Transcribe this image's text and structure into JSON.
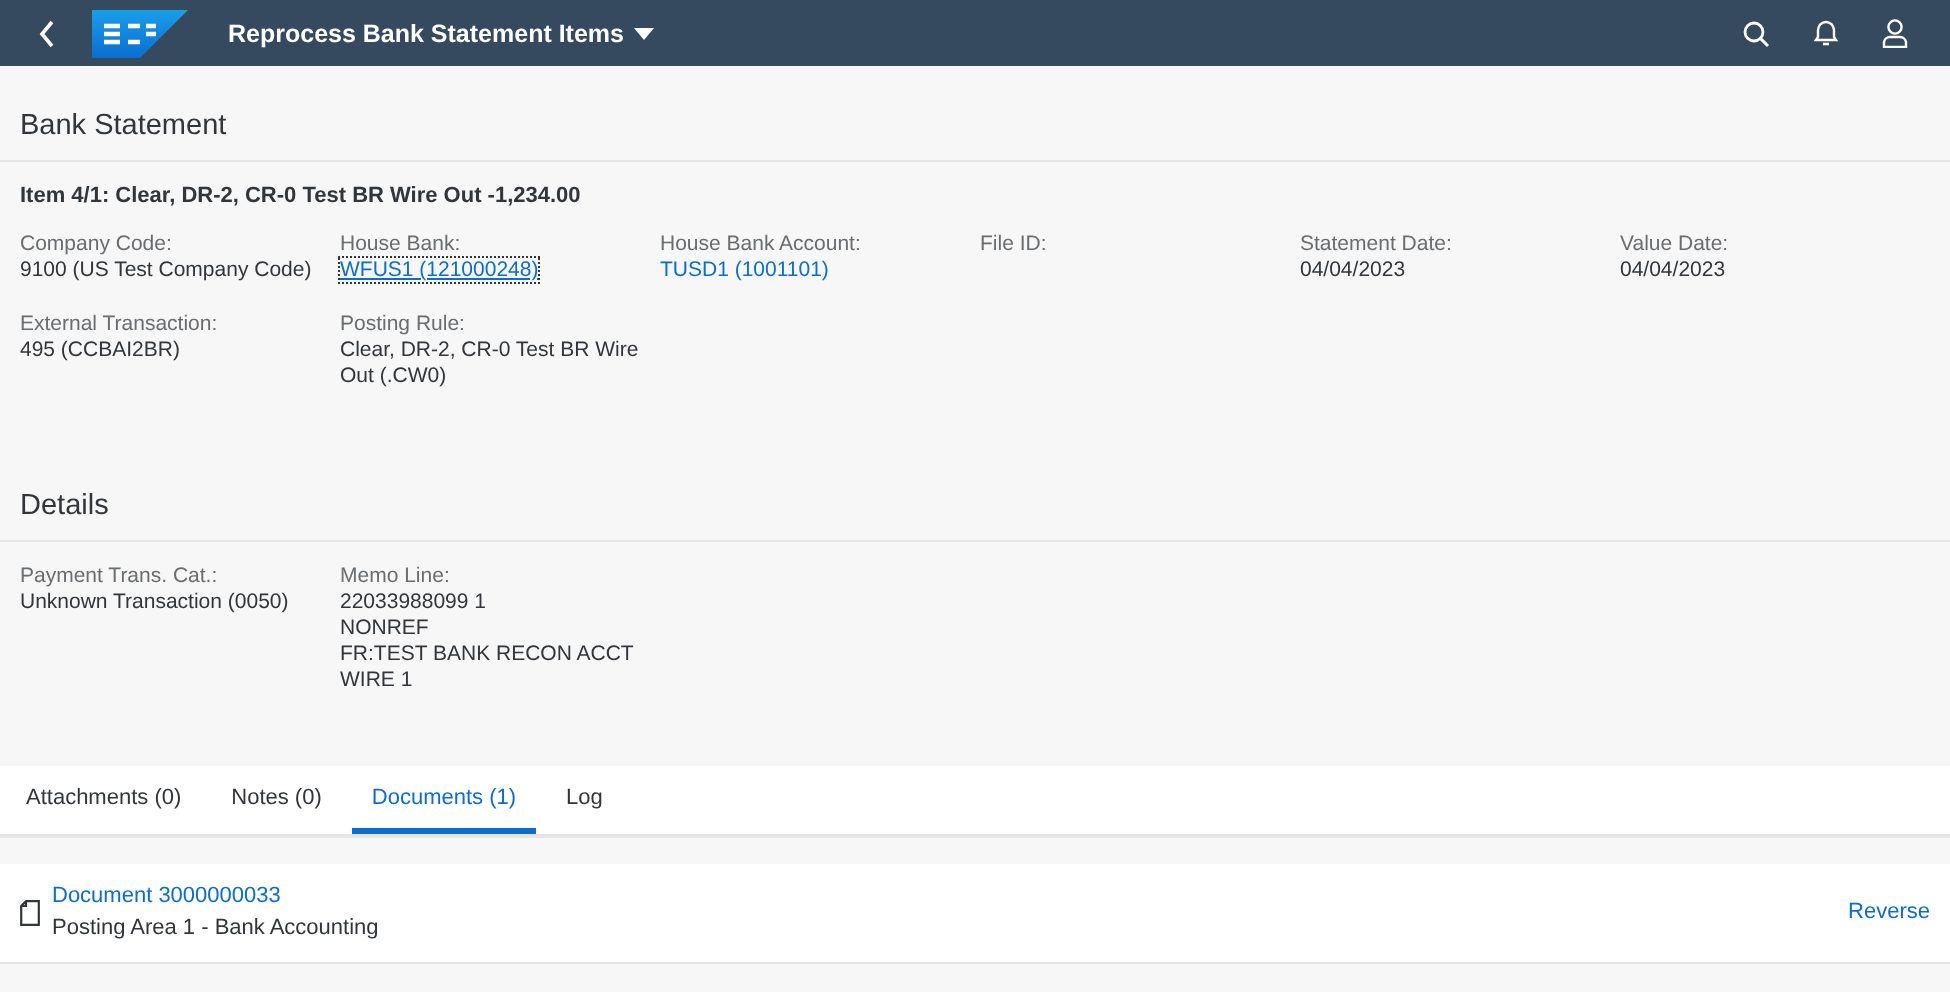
{
  "shell": {
    "title": "Reprocess Bank Statement Items"
  },
  "sections": [
    {
      "title": "Bank Statement",
      "subtitle": "Item 4/1: Clear, DR-2, CR-0 Test BR Wire Out -1,234.00",
      "rows": [
        [
          {
            "label": "Company Code:",
            "lines": [
              "9100 (US Test Company Code)"
            ],
            "kind": "text"
          },
          {
            "label": "House Bank:",
            "lines": [
              "WFUS1 (121000248)"
            ],
            "kind": "link",
            "focused": true
          },
          {
            "label": "House Bank Account:",
            "lines": [
              "TUSD1 (1001101)"
            ],
            "kind": "link",
            "focused": false
          },
          {
            "label": "File ID:"
          },
          {
            "label": "Statement Date:",
            "lines": [
              "04/04/2023"
            ],
            "kind": "text"
          },
          {
            "label": "Value Date:",
            "lines": [
              "04/04/2023"
            ],
            "kind": "text"
          }
        ],
        [
          {
            "label": "External Transaction:",
            "lines": [
              "495 (CCBAI2BR)"
            ],
            "kind": "text"
          },
          {
            "label": "Posting Rule:",
            "lines": [
              "Clear, DR-2, CR-0 Test BR Wire Out (.CW0)"
            ],
            "kind": "text"
          }
        ]
      ]
    },
    {
      "title": "Details",
      "rows": [
        [
          {
            "label": "Payment Trans. Cat.:",
            "lines": [
              "Unknown Transaction (0050)"
            ],
            "kind": "text"
          },
          {
            "label": "Memo Line:",
            "lines": [
              "22033988099 1",
              "NONREF",
              "FR:TEST BANK RECON ACCT",
              "WIRE 1"
            ],
            "kind": "text"
          }
        ]
      ]
    }
  ],
  "tabs": [
    {
      "label": "Attachments (0)",
      "selected": false
    },
    {
      "label": "Notes (0)",
      "selected": false
    },
    {
      "label": "Documents (1)",
      "selected": true
    },
    {
      "label": "Log",
      "selected": false
    }
  ],
  "documents": [
    {
      "title": "Document 3000000033",
      "description": "Posting Area 1 - Bank Accounting",
      "action": "Reverse"
    }
  ]
}
